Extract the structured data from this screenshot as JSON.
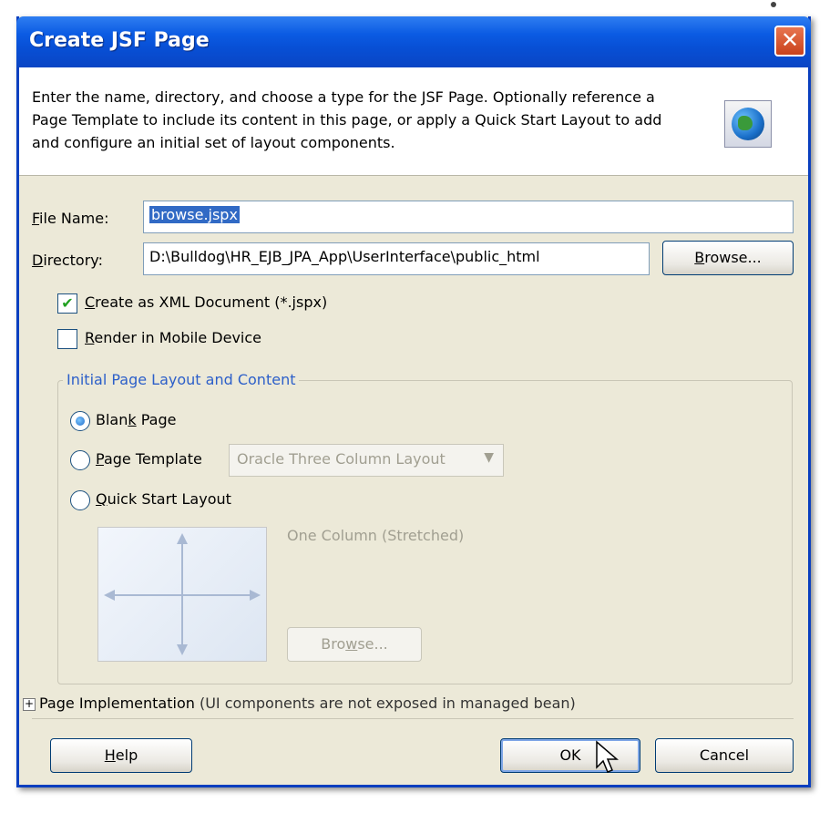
{
  "window": {
    "title": "Create JSF Page",
    "close_glyph": "✕"
  },
  "header": {
    "description": "Enter the name, directory, and choose a type for the JSF Page. Optionally reference a Page Template to include its content in this page, or apply a Quick Start Layout to add and configure an initial set of layout components.",
    "icon": "globe-icon"
  },
  "form": {
    "file_name": {
      "label_underlined": "F",
      "label_rest": "ile Name:",
      "value": "browse.jspx"
    },
    "directory": {
      "label_underlined": "D",
      "label_rest": "irectory:",
      "value": "D:\\Bulldog\\HR_EJB_JPA_App\\UserInterface\\public_html"
    },
    "browse_button": {
      "underlined": "B",
      "rest": "rowse..."
    },
    "create_xml": {
      "checked": true,
      "underlined": "C",
      "rest": "reate as XML Document (*.jspx)",
      "check_glyph": "✔"
    },
    "render_mobile": {
      "checked": false,
      "underlined": "R",
      "rest": "ender in Mobile Device"
    }
  },
  "layout_group": {
    "title": "Initial Page Layout and Content",
    "blank_page": {
      "selected": true,
      "before": "Blan",
      "underlined": "k",
      "after": " Page"
    },
    "page_template": {
      "selected": false,
      "underlined": "P",
      "rest": "age Template",
      "combo_value": "Oracle Three Column Layout",
      "combo_arrow": "▼"
    },
    "quick_start": {
      "selected": false,
      "underlined": "Q",
      "rest": "uick Start Layout"
    },
    "preview_caption": "One Column (Stretched)",
    "preview_browse": {
      "before": "Bro",
      "underlined": "w",
      "after": "se..."
    }
  },
  "page_implementation": {
    "toggle": "+",
    "label": "Page Implementation",
    "note": "(UI components are not exposed in managed bean)"
  },
  "footer": {
    "help": {
      "underlined": "H",
      "rest": "elp"
    },
    "ok": "OK",
    "cancel": "Cancel"
  },
  "colors": {
    "titlebar": "#0b5be3",
    "dialog_bg": "#ece9d8",
    "group_title": "#2c5fc9",
    "selection": "#316ac5"
  }
}
